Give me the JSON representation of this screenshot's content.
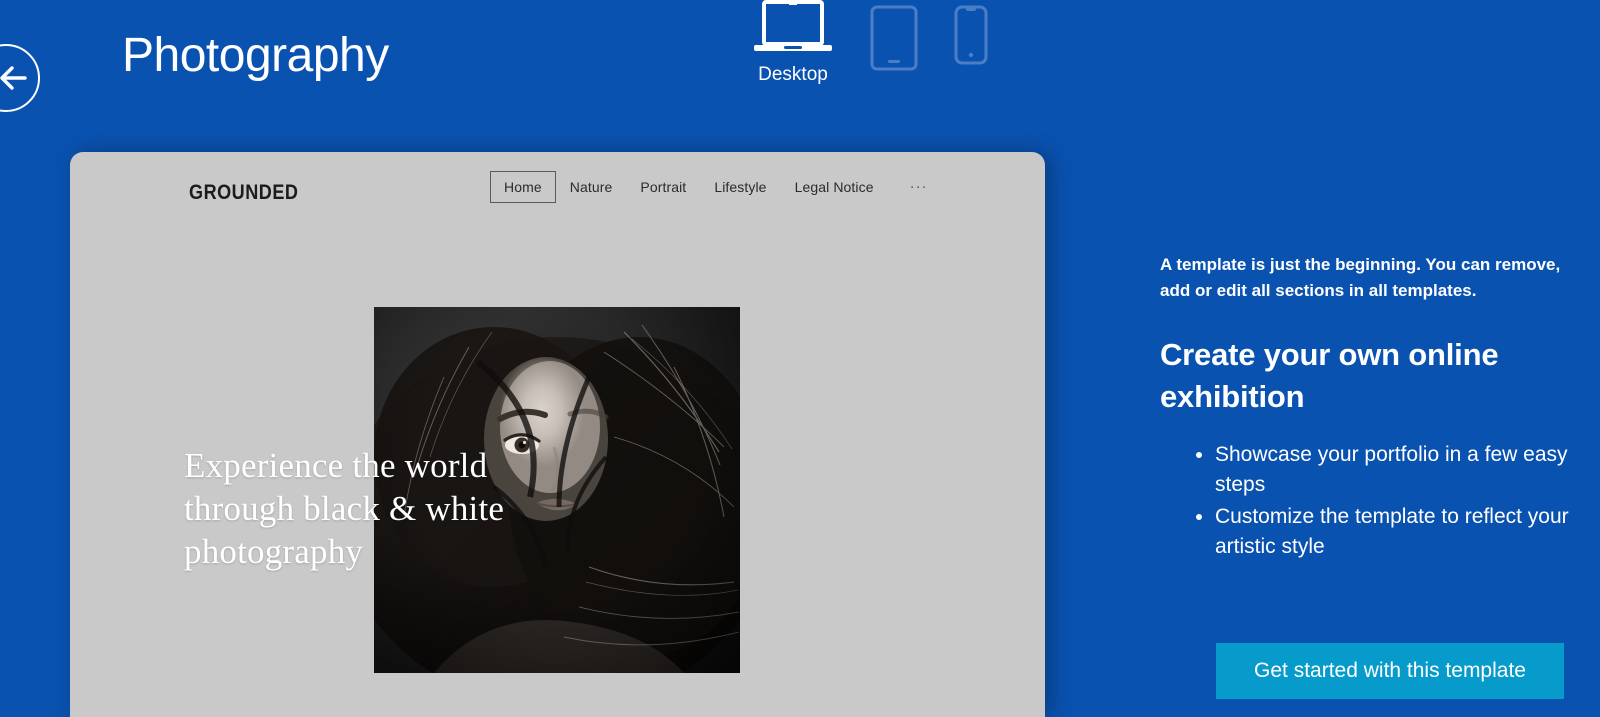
{
  "theme": {
    "background_blue": "#0a52b0",
    "card_gray": "#c9c9c9",
    "cta_cyan": "#079bcb",
    "inactive_icon_blue": "#4a7fc8",
    "white": "#ffffff"
  },
  "header": {
    "back_button_icon": "arrow-left-icon",
    "title": "Photography"
  },
  "device_switcher": {
    "options": [
      {
        "id": "desktop",
        "label": "Desktop",
        "icon": "laptop-icon",
        "selected": true
      },
      {
        "id": "tablet",
        "label": "",
        "icon": "tablet-icon",
        "selected": false
      },
      {
        "id": "mobile",
        "label": "",
        "icon": "mobile-icon",
        "selected": false
      }
    ]
  },
  "preview": {
    "site": {
      "logo": "GROUNDED",
      "menu": [
        {
          "label": "Home",
          "active": true
        },
        {
          "label": "Nature",
          "active": false
        },
        {
          "label": "Portrait",
          "active": false
        },
        {
          "label": "Lifestyle",
          "active": false
        },
        {
          "label": "Legal Notice",
          "active": false
        }
      ],
      "more_label": "···",
      "hero_headline": "Experience the world through black & white photography",
      "hero_image_alt": "black-and-white-portrait-of-woman-with-flowing-hair"
    }
  },
  "info_panel": {
    "intro": "A template is just the beginning. You can remove, add or edit all sections in all templates.",
    "heading": "Create your own online exhibition",
    "bullets": [
      "Showcase your portfolio in a few easy steps",
      "Customize the template to reflect your artistic style"
    ],
    "cta_label": "Get started with this template"
  }
}
